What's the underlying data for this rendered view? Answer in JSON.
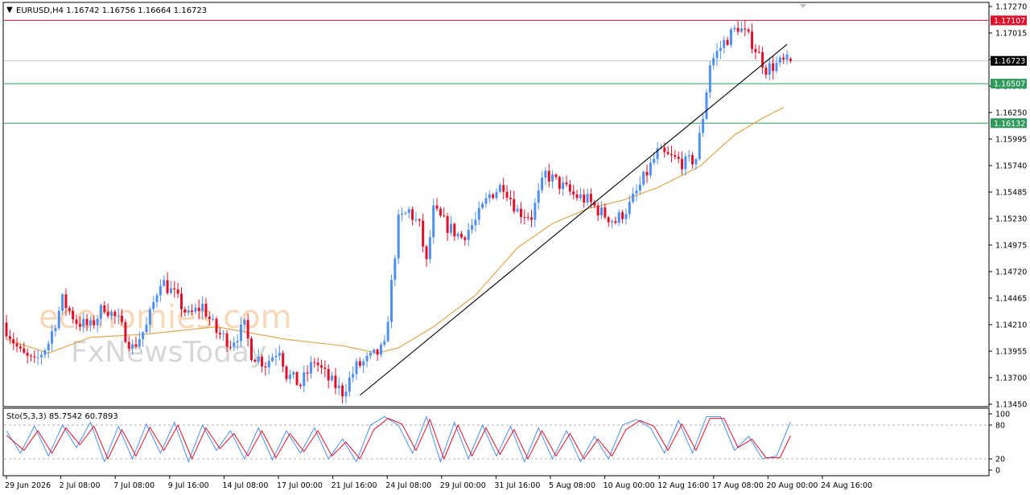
{
  "header": {
    "dropdown_glyph": "▼",
    "info": "EURUSD,H4  1.16742 1.16756 1.16664 1.16723"
  },
  "stoch_header": "Sto(5,3,3) 85.7542 60.7893",
  "watermark": {
    "line1": "economies.com",
    "line2": "FxNewsToday"
  },
  "colors": {
    "bull": "#4f8ff0",
    "bear": "#e0102a",
    "ma": "#e3a64b",
    "resistance": "#e0102a",
    "support": "#2e9a5b",
    "price_line": "#c8c8c8",
    "trendline": "#000000",
    "stoch_main": "#4f8ff0",
    "stoch_signal": "#e0102a"
  },
  "price_axis": {
    "min": 1.1345,
    "max": 1.1727,
    "labels": [
      "1.17270",
      "1.17015",
      "1.16760",
      "1.16505",
      "1.16250",
      "1.15995",
      "1.15740",
      "1.15485",
      "1.15230",
      "1.14975",
      "1.14720",
      "1.14465",
      "1.14210",
      "1.13955",
      "1.13700",
      "1.13450"
    ]
  },
  "price_tags": [
    {
      "name": "resistance-tag",
      "value": 1.17107,
      "label": "1.17107",
      "kind": "resistance"
    },
    {
      "name": "current-price-tag",
      "value": 1.16723,
      "label": "1.16723",
      "kind": "current"
    },
    {
      "name": "support-tag-1",
      "value": 1.16507,
      "label": "1.16507",
      "kind": "support"
    },
    {
      "name": "support-tag-2",
      "value": 1.16132,
      "label": "1.16132",
      "kind": "support"
    }
  ],
  "stoch_axis": {
    "labels": [
      "100",
      "80",
      "20",
      "0"
    ],
    "levels": [
      80,
      20
    ]
  },
  "time_axis": [
    "29 Jun 2026",
    "2 Jul 08:00",
    "7 Jul 08:00",
    "9 Jul 16:00",
    "14 Jul 08:00",
    "17 Jul 00:00",
    "21 Jul 16:00",
    "24 Jul 08:00",
    "29 Jul 00:00",
    "31 Jul 16:00",
    "5 Aug 08:00",
    "10 Aug 00:00",
    "12 Aug 16:00",
    "17 Aug 08:00",
    "20 Aug 00:00",
    "24 Aug 16:00"
  ],
  "chart_data": [
    {
      "type": "candlestick",
      "symbol": "EURUSD",
      "timeframe": "H4",
      "ohlc_header": {
        "open": 1.16742,
        "high": 1.16756,
        "low": 1.16664,
        "close": 1.16723
      },
      "ylim": [
        1.1345,
        1.1727
      ],
      "waypoints": [
        [
          0,
          1.1418
        ],
        [
          4,
          1.1395
        ],
        [
          8,
          1.1385
        ],
        [
          12,
          1.1405
        ],
        [
          16,
          1.1445
        ],
        [
          20,
          1.1425
        ],
        [
          24,
          1.142
        ],
        [
          28,
          1.144
        ],
        [
          32,
          1.1425
        ],
        [
          36,
          1.14
        ],
        [
          40,
          1.142
        ],
        [
          44,
          1.1465
        ],
        [
          48,
          1.145
        ],
        [
          52,
          1.143
        ],
        [
          56,
          1.144
        ],
        [
          60,
          1.1415
        ],
        [
          64,
          1.1405
        ],
        [
          68,
          1.142
        ],
        [
          70,
          1.1395
        ],
        [
          74,
          1.1385
        ],
        [
          78,
          1.14
        ],
        [
          80,
          1.1375
        ],
        [
          84,
          1.1365
        ],
        [
          88,
          1.1388
        ],
        [
          92,
          1.137
        ],
        [
          96,
          1.1358
        ],
        [
          100,
          1.1382
        ],
        [
          104,
          1.139
        ],
        [
          108,
          1.14
        ],
        [
          110,
          1.146
        ],
        [
          112,
          1.152
        ],
        [
          115,
          1.153
        ],
        [
          118,
          1.1515
        ],
        [
          120,
          1.148
        ],
        [
          122,
          1.153
        ],
        [
          126,
          1.1515
        ],
        [
          130,
          1.1505
        ],
        [
          134,
          1.152
        ],
        [
          138,
          1.1545
        ],
        [
          142,
          1.1555
        ],
        [
          146,
          1.153
        ],
        [
          150,
          1.1525
        ],
        [
          154,
          1.1565
        ],
        [
          158,
          1.1555
        ],
        [
          162,
          1.1545
        ],
        [
          166,
          1.154
        ],
        [
          170,
          1.1528
        ],
        [
          174,
          1.152
        ],
        [
          178,
          1.1535
        ],
        [
          182,
          1.156
        ],
        [
          186,
          1.1585
        ],
        [
          190,
          1.158
        ],
        [
          194,
          1.1575
        ],
        [
          197,
          1.158
        ],
        [
          199,
          1.162
        ],
        [
          201,
          1.167
        ],
        [
          205,
          1.169
        ],
        [
          209,
          1.1705
        ],
        [
          213,
          1.169
        ],
        [
          217,
          1.1665
        ],
        [
          221,
          1.167
        ],
        [
          224,
          1.16723
        ]
      ],
      "moving_average": {
        "color": "#e3a64b",
        "waypoints": [
          [
            0,
            1.1408
          ],
          [
            12,
            1.1395
          ],
          [
            24,
            1.141
          ],
          [
            40,
            1.1413
          ],
          [
            60,
            1.142
          ],
          [
            80,
            1.1408
          ],
          [
            96,
            1.1402
          ],
          [
            106,
            1.1395
          ],
          [
            112,
            1.14
          ],
          [
            122,
            1.142
          ],
          [
            134,
            1.145
          ],
          [
            146,
            1.1495
          ],
          [
            156,
            1.1518
          ],
          [
            166,
            1.1532
          ],
          [
            176,
            1.154
          ],
          [
            186,
            1.1552
          ],
          [
            198,
            1.1572
          ],
          [
            208,
            1.1602
          ],
          [
            216,
            1.1618
          ],
          [
            222,
            1.1628
          ]
        ]
      },
      "trendline": {
        "color": "#000000",
        "from": {
          "bar": 101,
          "price": 1.1355
        },
        "to": {
          "bar": 223,
          "price": 1.1688
        }
      },
      "horizontal_levels": [
        {
          "price": 1.17107,
          "color": "#e0102a"
        },
        {
          "price": 1.16723,
          "color": "#c8c8c8"
        },
        {
          "price": 1.16507,
          "color": "#2e9a5b"
        },
        {
          "price": 1.16132,
          "color": "#2e9a5b"
        }
      ]
    },
    {
      "type": "line",
      "name": "Stochastic oscillator",
      "params": "5,3,3",
      "ylim": [
        0,
        100
      ],
      "levels": [
        80,
        20
      ],
      "series": [
        {
          "name": "main",
          "color": "#4f8ff0",
          "current": 85.7542,
          "waypoints": [
            [
              0,
              70
            ],
            [
              4,
              30
            ],
            [
              8,
              78
            ],
            [
              12,
              25
            ],
            [
              16,
              80
            ],
            [
              20,
              40
            ],
            [
              24,
              85
            ],
            [
              28,
              15
            ],
            [
              32,
              78
            ],
            [
              36,
              20
            ],
            [
              40,
              82
            ],
            [
              44,
              30
            ],
            [
              48,
              85
            ],
            [
              52,
              15
            ],
            [
              56,
              80
            ],
            [
              60,
              35
            ],
            [
              64,
              70
            ],
            [
              68,
              20
            ],
            [
              72,
              75
            ],
            [
              76,
              18
            ],
            [
              80,
              70
            ],
            [
              84,
              30
            ],
            [
              88,
              75
            ],
            [
              92,
              20
            ],
            [
              96,
              55
            ],
            [
              100,
              15
            ],
            [
              104,
              80
            ],
            [
              108,
              95
            ],
            [
              112,
              80
            ],
            [
              116,
              30
            ],
            [
              120,
              95
            ],
            [
              124,
              15
            ],
            [
              128,
              85
            ],
            [
              132,
              20
            ],
            [
              136,
              80
            ],
            [
              140,
              25
            ],
            [
              144,
              78
            ],
            [
              148,
              15
            ],
            [
              152,
              75
            ],
            [
              156,
              20
            ],
            [
              160,
              70
            ],
            [
              164,
              15
            ],
            [
              168,
              60
            ],
            [
              172,
              20
            ],
            [
              176,
              80
            ],
            [
              180,
              90
            ],
            [
              184,
              75
            ],
            [
              188,
              30
            ],
            [
              192,
              88
            ],
            [
              196,
              30
            ],
            [
              200,
              95
            ],
            [
              204,
              95
            ],
            [
              208,
              35
            ],
            [
              212,
              60
            ],
            [
              216,
              20
            ],
            [
              220,
              25
            ],
            [
              224,
              85.7542
            ]
          ]
        },
        {
          "name": "signal",
          "color": "#e0102a",
          "current": 60.7893,
          "waypoints": [
            [
              0,
              62
            ],
            [
              5,
              35
            ],
            [
              9,
              70
            ],
            [
              13,
              30
            ],
            [
              17,
              75
            ],
            [
              21,
              45
            ],
            [
              25,
              78
            ],
            [
              29,
              20
            ],
            [
              33,
              72
            ],
            [
              37,
              25
            ],
            [
              41,
              76
            ],
            [
              45,
              35
            ],
            [
              49,
              80
            ],
            [
              53,
              20
            ],
            [
              57,
              75
            ],
            [
              61,
              38
            ],
            [
              65,
              65
            ],
            [
              69,
              25
            ],
            [
              73,
              70
            ],
            [
              77,
              22
            ],
            [
              81,
              65
            ],
            [
              85,
              33
            ],
            [
              89,
              70
            ],
            [
              93,
              25
            ],
            [
              97,
              50
            ],
            [
              101,
              20
            ],
            [
              105,
              72
            ],
            [
              109,
              92
            ],
            [
              113,
              82
            ],
            [
              117,
              35
            ],
            [
              121,
              90
            ],
            [
              125,
              20
            ],
            [
              129,
              80
            ],
            [
              133,
              25
            ],
            [
              137,
              75
            ],
            [
              141,
              28
            ],
            [
              145,
              72
            ],
            [
              149,
              20
            ],
            [
              153,
              70
            ],
            [
              157,
              25
            ],
            [
              161,
              65
            ],
            [
              165,
              20
            ],
            [
              169,
              55
            ],
            [
              173,
              25
            ],
            [
              177,
              72
            ],
            [
              181,
              88
            ],
            [
              185,
              78
            ],
            [
              189,
              35
            ],
            [
              193,
              82
            ],
            [
              197,
              35
            ],
            [
              201,
              92
            ],
            [
              205,
              92
            ],
            [
              209,
              40
            ],
            [
              213,
              55
            ],
            [
              217,
              22
            ],
            [
              221,
              22
            ],
            [
              224,
              60.7893
            ]
          ]
        }
      ]
    }
  ]
}
